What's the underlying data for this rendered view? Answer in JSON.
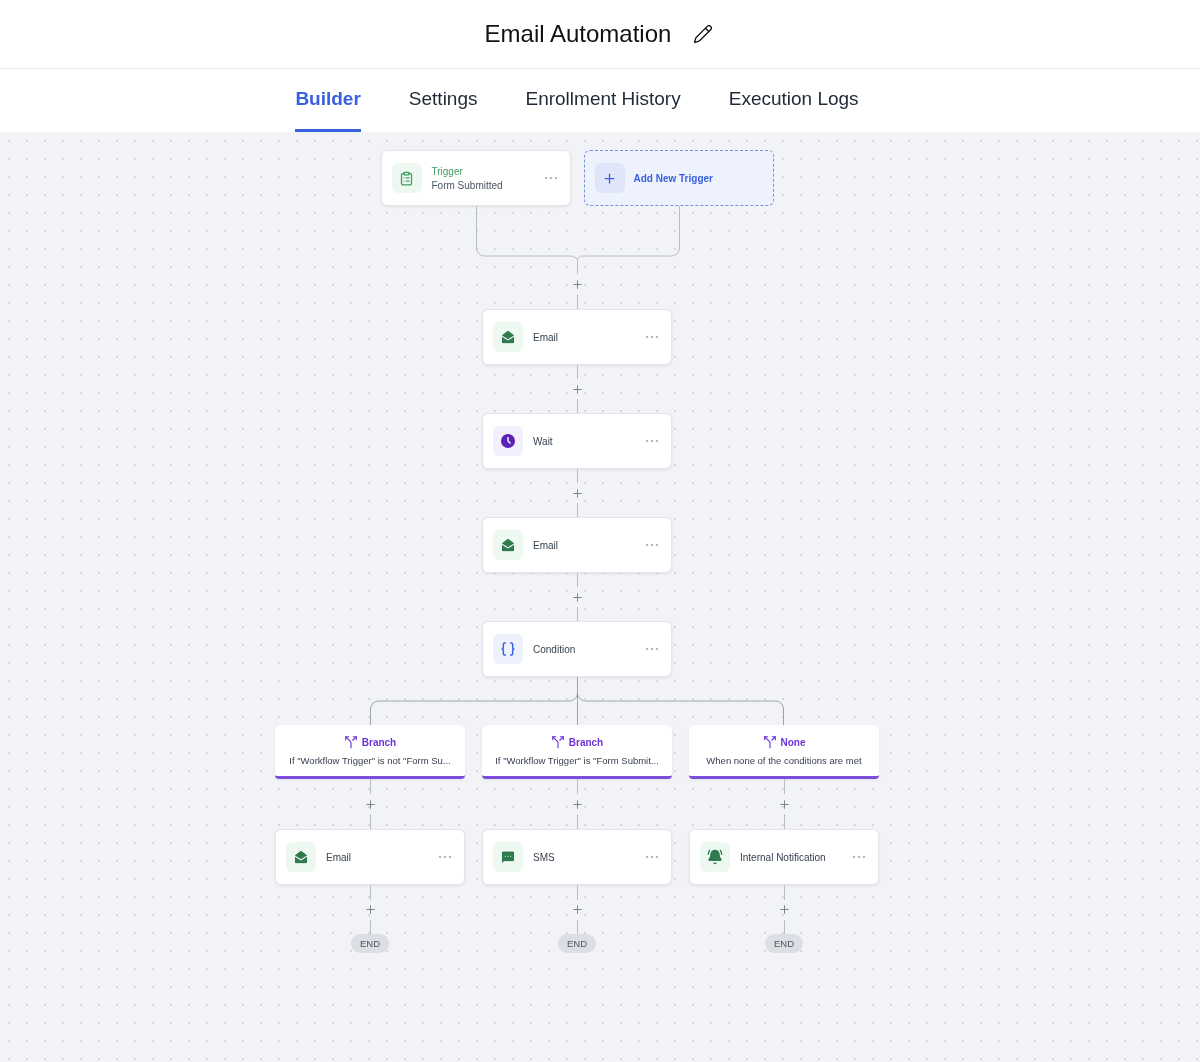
{
  "header": {
    "title": "Email Automation"
  },
  "tabs": [
    {
      "label": "Builder",
      "selected": true
    },
    {
      "label": "Settings",
      "selected": false
    },
    {
      "label": "Enrollment History",
      "selected": false
    },
    {
      "label": "Execution Logs",
      "selected": false
    }
  ],
  "trigger": {
    "label": "Trigger",
    "value": "Form Submitted"
  },
  "add_trigger": {
    "label": "Add New Trigger"
  },
  "steps": [
    {
      "kind": "email",
      "label": "Email"
    },
    {
      "kind": "wait",
      "label": "Wait"
    },
    {
      "kind": "email",
      "label": "Email"
    },
    {
      "kind": "condition",
      "label": "Condition"
    }
  ],
  "branches": [
    {
      "label": "Branch",
      "condition": "If \"Workflow Trigger\" is not \"Form Su...",
      "steps": [
        {
          "kind": "email",
          "label": "Email"
        }
      ],
      "end": "END"
    },
    {
      "label": "Branch",
      "condition": "If \"Workflow Trigger\" is \"Form Submit...",
      "steps": [
        {
          "kind": "sms",
          "label": "SMS"
        }
      ],
      "end": "END"
    },
    {
      "label": "None",
      "condition": "When none of the conditions are met",
      "steps": [
        {
          "kind": "notification",
          "label": "Internal Notification"
        }
      ],
      "end": "END"
    }
  ]
}
